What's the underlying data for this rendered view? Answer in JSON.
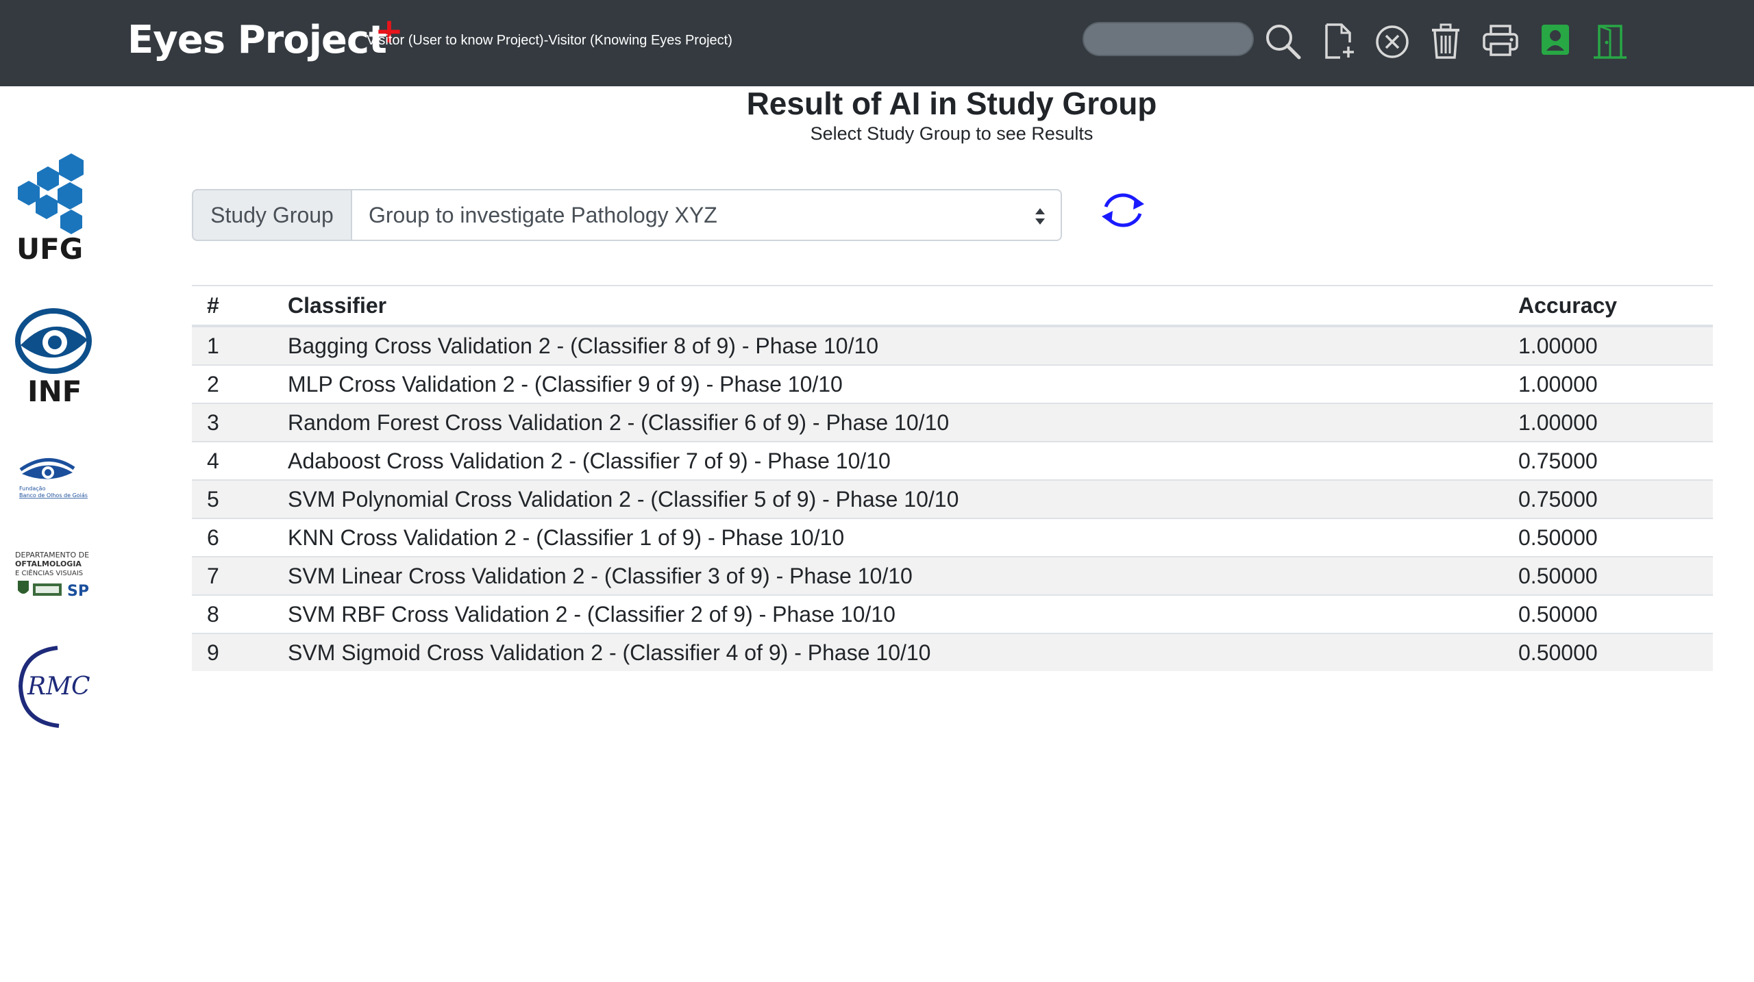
{
  "header": {
    "brand": "Eyes Project",
    "brand_plus": "+",
    "visitor_text": "Visitor (User to know Project)-Visitor (Knowing Eyes Project)",
    "search_placeholder": "",
    "icons": [
      "search-icon",
      "new-document-icon",
      "cancel-icon",
      "trash-icon",
      "print-icon",
      "user-profile-icon",
      "exit-door-icon"
    ],
    "accent_green": "#28a745"
  },
  "sidebar": {
    "logos": [
      {
        "name": "ufg-logo",
        "text": "UFG",
        "color": "#1b75bc"
      },
      {
        "name": "inf-logo",
        "text": "INF",
        "color": "#0d4f8b"
      },
      {
        "name": "fundacao-banco-de-olhos-logo",
        "text": "Fundação Banco de Olhos de Goiás"
      },
      {
        "name": "departamento-oftalmologia-logo",
        "text": "DEPARTAMENTO DE OFTALMOLOGIA E CIÊNCIAS VISUAIS"
      },
      {
        "name": "rmc-logo",
        "text": "RMC"
      }
    ]
  },
  "main": {
    "title": "Result of AI in Study Group",
    "subtitle": "Select Study Group to see Results",
    "study_group_label": "Study Group",
    "study_group_selected": "Group to investigate Pathology XYZ",
    "table": {
      "headers": [
        "#",
        "Classifier",
        "Accuracy"
      ],
      "rows": [
        [
          "1",
          "Bagging Cross Validation 2 - (Classifier 8 of 9) - Phase 10/10",
          "1.00000"
        ],
        [
          "2",
          "MLP Cross Validation 2 - (Classifier 9 of 9) - Phase 10/10",
          "1.00000"
        ],
        [
          "3",
          "Random Forest Cross Validation 2 - (Classifier 6 of 9) - Phase 10/10",
          "1.00000"
        ],
        [
          "4",
          "Adaboost Cross Validation 2 - (Classifier 7 of 9) - Phase 10/10",
          "0.75000"
        ],
        [
          "5",
          "SVM Polynomial Cross Validation 2 - (Classifier 5 of 9) - Phase 10/10",
          "0.75000"
        ],
        [
          "6",
          "KNN Cross Validation 2 - (Classifier 1 of 9) - Phase 10/10",
          "0.50000"
        ],
        [
          "7",
          "SVM Linear Cross Validation 2 - (Classifier 3 of 9) - Phase 10/10",
          "0.50000"
        ],
        [
          "8",
          "SVM RBF Cross Validation 2 - (Classifier 2 of 9) - Phase 10/10",
          "0.50000"
        ],
        [
          "9",
          "SVM Sigmoid Cross Validation 2 - (Classifier 4 of 9) - Phase 10/10",
          "0.50000"
        ]
      ]
    },
    "refresh_color": "#1a1aff"
  }
}
